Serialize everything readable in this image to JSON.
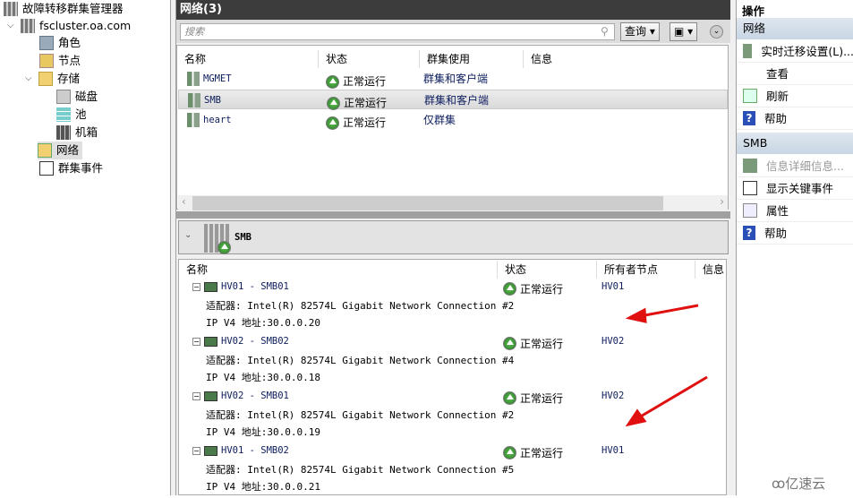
{
  "tree": {
    "root": "故障转移群集管理器",
    "cluster": "fscluster.oa.com",
    "items": [
      "角色",
      "节点",
      "存储",
      "磁盘",
      "池",
      "机箱",
      "网络",
      "群集事件"
    ]
  },
  "center": {
    "title": "网络(3)",
    "search_placeholder": "搜索",
    "query_button": "查询",
    "columns": [
      "名称",
      "状态",
      "群集使用",
      "信息"
    ],
    "rows": [
      {
        "name": "MGMET",
        "status": "正常运行",
        "use": "群集和客户端"
      },
      {
        "name": "SMB",
        "status": "正常运行",
        "use": "群集和客户端"
      },
      {
        "name": "heart",
        "status": "正常运行",
        "use": "仅群集"
      }
    ],
    "selected": "SMB"
  },
  "detail": {
    "title": "SMB",
    "columns": [
      "名称",
      "状态",
      "所有者节点",
      "信息"
    ],
    "items": [
      {
        "name": "HV01 - SMB01",
        "adapter": "适配器: Intel(R) 82574L Gigabit Network Connection #2",
        "ip": "IP V4 地址:30.0.0.20",
        "status": "正常运行",
        "owner": "HV01"
      },
      {
        "name": "HV02 - SMB02",
        "adapter": "适配器: Intel(R) 82574L Gigabit Network Connection #4",
        "ip": "IP V4 地址:30.0.0.18",
        "status": "正常运行",
        "owner": "HV02"
      },
      {
        "name": "HV02 - SMB01",
        "adapter": "适配器: Intel(R) 82574L Gigabit Network Connection #2",
        "ip": "IP V4 地址:30.0.0.19",
        "status": "正常运行",
        "owner": "HV02"
      },
      {
        "name": "HV01 - SMB02",
        "adapter": "适配器: Intel(R) 82574L Gigabit Network Connection #5",
        "ip": "IP V4 地址:30.0.0.21",
        "status": "正常运行",
        "owner": "HV01"
      }
    ]
  },
  "actions": {
    "title": "操作",
    "sections": [
      {
        "title": "网络",
        "items": [
          "实时迁移设置(L)...",
          "查看",
          "刷新",
          "帮助"
        ]
      },
      {
        "title": "SMB",
        "items": [
          "信息详细信息...",
          "显示关键事件",
          "属性",
          "帮助"
        ]
      }
    ]
  },
  "watermark": "亿速云",
  "colors": {
    "annotation_arrow": "#e01010",
    "title_bar": "#3c3c3c",
    "section_header": "#c8d5e3"
  }
}
